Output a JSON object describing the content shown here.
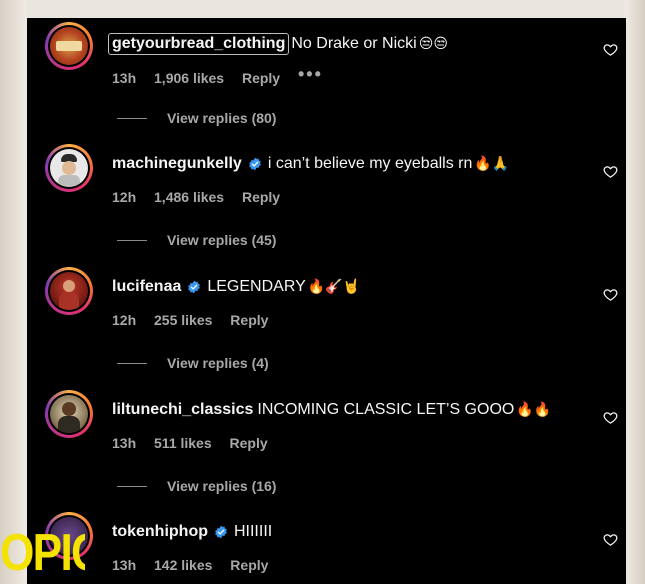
{
  "comments": [
    {
      "username": "getyourbread_clothing",
      "verified": false,
      "text": "No Drake or Nicki",
      "emoji": "😒😒",
      "time": "13h",
      "likes": "1,906 likes",
      "reply_label": "Reply",
      "more_label": "•••",
      "view_replies": "View replies (80)"
    },
    {
      "username": "machinegunkelly",
      "verified": true,
      "text": "i can’t believe my eyeballs rn",
      "emoji": "🔥🙏",
      "time": "12h",
      "likes": "1,486 likes",
      "reply_label": "Reply",
      "view_replies": "View replies (45)"
    },
    {
      "username": "lucifenaa",
      "verified": true,
      "text": "LEGENDARY",
      "emoji": "🔥🎸🤘",
      "time": "12h",
      "likes": "255 likes",
      "reply_label": "Reply",
      "view_replies": "View replies (4)"
    },
    {
      "username": "liltunechi_classics",
      "verified": false,
      "text": "INCOMING CLASSIC LET’S GOOO",
      "emoji": "🔥🔥",
      "time": "13h",
      "likes": "511 likes",
      "reply_label": "Reply",
      "view_replies": "View replies (16)"
    },
    {
      "username": "tokenhiphop",
      "verified": true,
      "text": "HIIIIII",
      "emoji": "",
      "time": "13h",
      "likes": "142 likes",
      "reply_label": "Reply"
    }
  ],
  "overlay": {
    "watermark_text": "OPIC"
  },
  "colors": {
    "background": "#000000",
    "text": "#f5f5f5",
    "secondary": "#a8a8a8",
    "verified": "#3897f0",
    "watermark": "#f4e200"
  },
  "icons": {
    "like": "heart-outline-icon",
    "verified": "verified-badge-icon"
  }
}
